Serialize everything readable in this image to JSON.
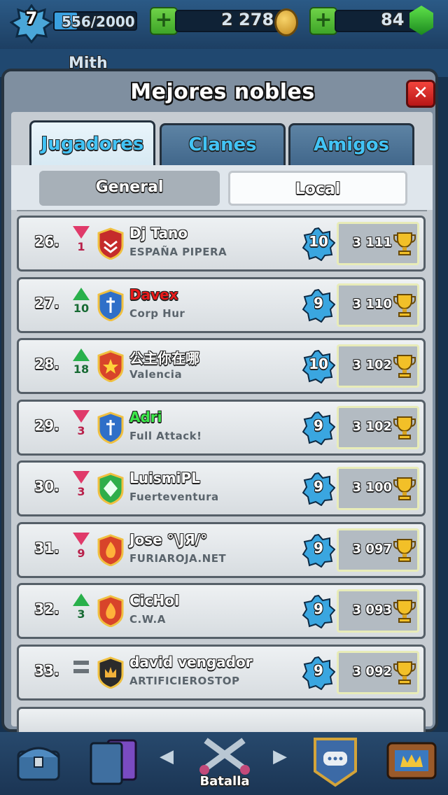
{
  "header": {
    "level": "7",
    "xp": "556/2000",
    "xp_progress": 0.278,
    "gold": "2 278",
    "gems": "84",
    "gold_plus": "+",
    "gems_plus": "+"
  },
  "behind": {
    "player_name": "Mith"
  },
  "modal": {
    "title": "Mejores nobles",
    "close_label": "✕",
    "tabs": [
      {
        "label": "Jugadores",
        "active": true
      },
      {
        "label": "Clanes",
        "active": false
      },
      {
        "label": "Amigos",
        "active": false
      }
    ],
    "subtabs": [
      {
        "label": "General",
        "selected": true
      },
      {
        "label": "Local",
        "selected": false
      }
    ]
  },
  "leaderboard": [
    {
      "rank": "26.",
      "trend": "down",
      "change": "1",
      "name": "Dj Tano",
      "name_color": "#ffffff",
      "clan": "ESPAÑA PIPERA",
      "badge": "chevron-badge",
      "badge_color": "#c52b2b",
      "level": "10",
      "trophies": "3 111"
    },
    {
      "rank": "27.",
      "trend": "up",
      "change": "10",
      "name": "Davex",
      "name_color": "#e81a1a",
      "clan": "Corp Hur",
      "badge": "sword-shield-badge",
      "badge_color": "#2f6fc8",
      "level": "9",
      "trophies": "3 110"
    },
    {
      "rank": "28.",
      "trend": "up",
      "change": "18",
      "name": "公主你在哪",
      "name_color": "#ffffff",
      "clan": "Valencia",
      "badge": "star-shield-badge",
      "badge_color": "#d8442a",
      "level": "10",
      "trophies": "3 102"
    },
    {
      "rank": "29.",
      "trend": "down",
      "change": "3",
      "name": "Adri",
      "name_color": "#3ce84a",
      "clan": "Full Attack!",
      "badge": "sword-shield-badge",
      "badge_color": "#2f6fc8",
      "level": "9",
      "trophies": "3 102"
    },
    {
      "rank": "30.",
      "trend": "down",
      "change": "3",
      "name": "LuismiPL",
      "name_color": "#ffffff",
      "clan": "Fuerteventura",
      "badge": "diamond-shield-badge",
      "badge_color": "#2fae4a",
      "level": "9",
      "trophies": "3 100"
    },
    {
      "rank": "31.",
      "trend": "down",
      "change": "9",
      "name": "Jose °\\JЯ/°",
      "name_color": "#ffffff",
      "clan": "FURIAROJA.NET",
      "badge": "flame-shield-badge",
      "badge_color": "#d8442a",
      "level": "9",
      "trophies": "3 097"
    },
    {
      "rank": "32.",
      "trend": "up",
      "change": "3",
      "name": "CicHoI",
      "name_color": "#ffffff",
      "clan": "C.W.A",
      "badge": "flame-shield-badge",
      "badge_color": "#d8442a",
      "level": "9",
      "trophies": "3 093"
    },
    {
      "rank": "33.",
      "trend": "same",
      "change": "",
      "name": "david vengador",
      "name_color": "#ffffff",
      "clan": "ARTIFICIEROSTOP",
      "badge": "crown-shield-badge",
      "badge_color": "#2b2b2b",
      "level": "9",
      "trophies": "3 092"
    }
  ],
  "colors": {
    "trend_up": "#29b04b",
    "trend_down": "#e03a6a",
    "tab_text": "#42c3f5"
  },
  "bottom_nav": {
    "battle_label": "Batalla",
    "items": [
      "chest-icon",
      "cards-icon",
      "battle-swords-icon",
      "chat-icon",
      "tv-royale-icon"
    ]
  }
}
